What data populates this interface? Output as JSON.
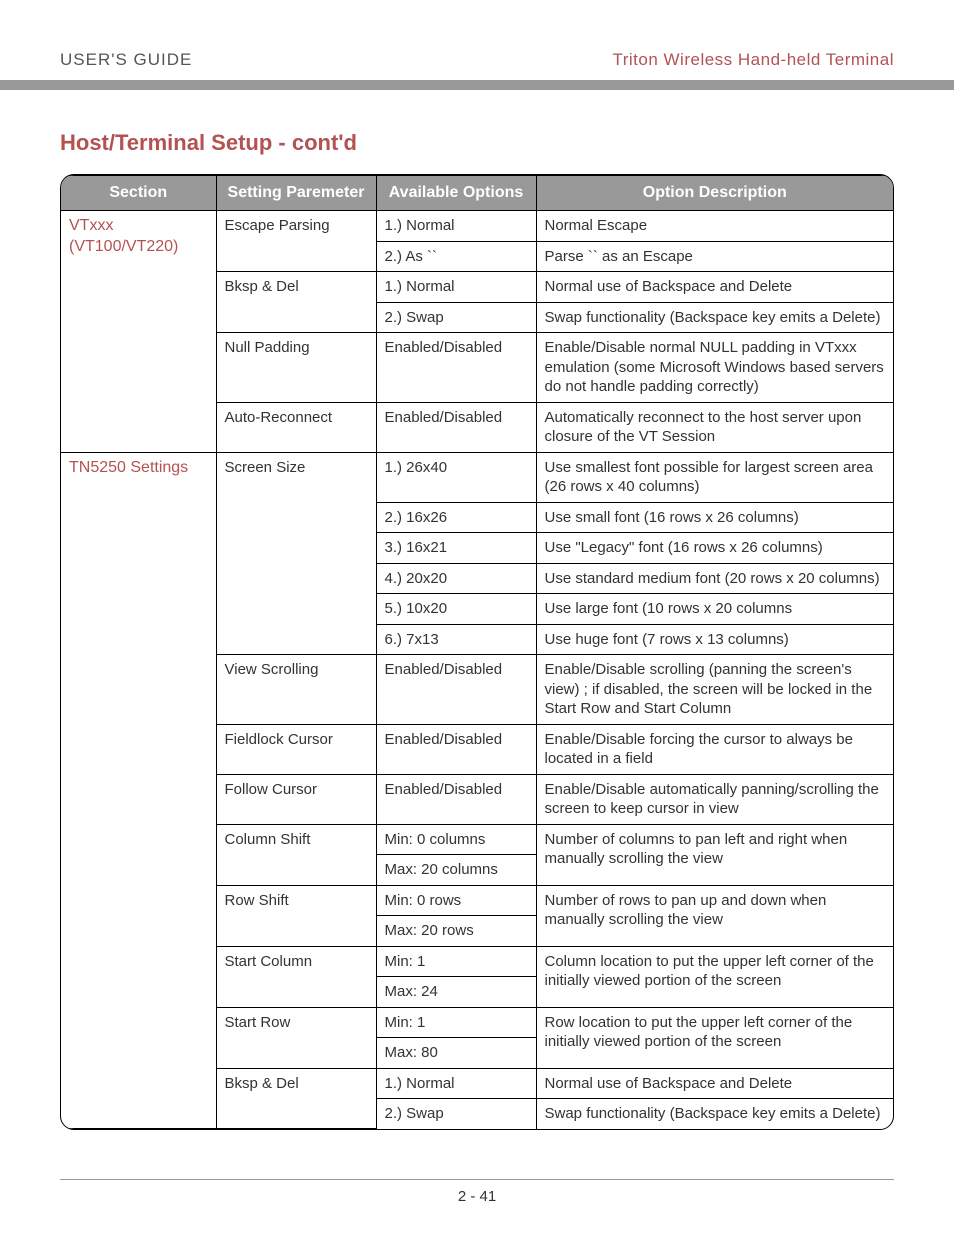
{
  "header": {
    "left": "USER'S GUIDE",
    "right": "Triton Wireless Hand-held Terminal"
  },
  "title": "Host/Terminal Setup - cont'd",
  "columns": {
    "section": "Section",
    "param": "Setting Paremeter",
    "options": "Available Options",
    "desc": "Option Description"
  },
  "sections": {
    "vtxxx": "VTxxx (VT100/VT220)",
    "tn5250": "TN5250 Settings"
  },
  "rows": {
    "vt_escape_param": "Escape Parsing",
    "vt_escape_o1": "1.) Normal",
    "vt_escape_d1": "Normal Escape",
    "vt_escape_o2": "2.) As ``",
    "vt_escape_d2": "Parse `` as an Escape",
    "vt_bksp_param": "Bksp & Del",
    "vt_bksp_o1": "1.) Normal",
    "vt_bksp_d1": "Normal use of Backspace and Delete",
    "vt_bksp_o2": "2.) Swap",
    "vt_bksp_d2": "Swap functionality (Backspace key emits a Delete)",
    "vt_null_param": "Null Padding",
    "vt_null_o": "Enabled/Disabled",
    "vt_null_d": "Enable/Disable normal NULL padding in VTxxx emulation (some Microsoft Windows based servers do not handle padding correctly)",
    "vt_auto_param": "Auto-Reconnect",
    "vt_auto_o": "Enabled/Disabled",
    "vt_auto_d": "Automatically reconnect to the host server upon closure of the VT Session",
    "tn_ss_param": "Screen Size",
    "tn_ss_o1": "1.) 26x40",
    "tn_ss_d1": "Use smallest font possible for largest screen area (26 rows x 40 columns)",
    "tn_ss_o2": "2.) 16x26",
    "tn_ss_d2": "Use small font (16 rows x 26 columns)",
    "tn_ss_o3": "3.) 16x21",
    "tn_ss_d3": "Use \"Legacy\" font (16 rows x 26 columns)",
    "tn_ss_o4": "4.) 20x20",
    "tn_ss_d4": "Use standard medium font (20 rows x 20 columns)",
    "tn_ss_o5": "5.) 10x20",
    "tn_ss_d5": "Use large font (10 rows x 20 columns",
    "tn_ss_o6": "6.) 7x13",
    "tn_ss_d6": "Use huge font (7 rows x 13 columns)",
    "tn_vs_param": "View Scrolling",
    "tn_vs_o": "Enabled/Disabled",
    "tn_vs_d": "Enable/Disable scrolling (panning the screen's view) ; if disabled, the screen will be locked in the Start Row and Start Column",
    "tn_flc_param": "Fieldlock Cursor",
    "tn_flc_o": "Enabled/Disabled",
    "tn_flc_d": "Enable/Disable forcing the cursor to always be located in a field",
    "tn_fc_param": "Follow Cursor",
    "tn_fc_o": "Enabled/Disabled",
    "tn_fc_d": "Enable/Disable automatically panning/scrolling the screen to keep cursor in view",
    "tn_cs_param": "Column Shift",
    "tn_cs_o1": "Min: 0 columns",
    "tn_cs_o2": "Max: 20 columns",
    "tn_cs_d": "Number of columns to pan left and right when manually scrolling the view",
    "tn_rs_param": "Row Shift",
    "tn_rs_o1": "Min: 0 rows",
    "tn_rs_o2": "Max: 20 rows",
    "tn_rs_d": "Number of rows to pan up and down when manually scrolling the view",
    "tn_sc_param": "Start Column",
    "tn_sc_o1": "Min: 1",
    "tn_sc_o2": "Max: 24",
    "tn_sc_d": "Column location to put the upper left corner of the initially viewed portion of the screen",
    "tn_sr_param": "Start Row",
    "tn_sr_o1": "Min: 1",
    "tn_sr_o2": "Max: 80",
    "tn_sr_d": "Row location to put the upper left corner of the initially viewed portion of the screen",
    "tn_bksp_param": "Bksp & Del",
    "tn_bksp_o1": "1.) Normal",
    "tn_bksp_d1": "Normal use of Backspace and Delete",
    "tn_bksp_o2": "2.) Swap",
    "tn_bksp_d2": "Swap functionality (Backspace key emits a Delete)"
  },
  "footer": "2 - 41"
}
